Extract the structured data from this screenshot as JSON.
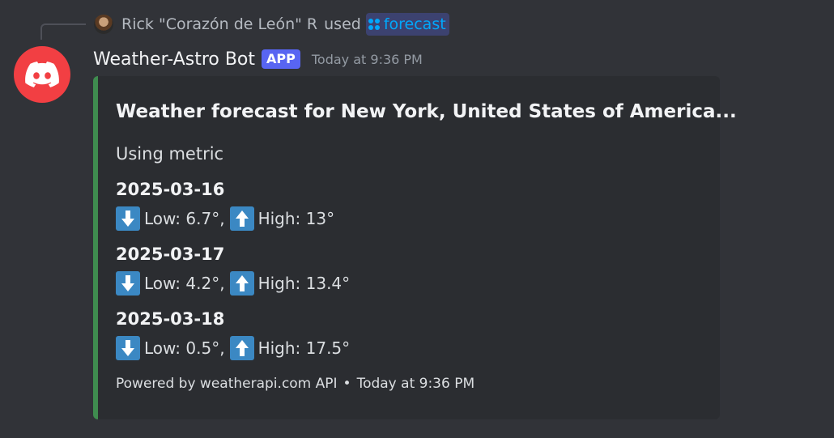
{
  "reply": {
    "user_name": "Rick \"Corazón de León\" R",
    "used_text": "used",
    "command": "forecast",
    "command_icon": "slash-command-icon"
  },
  "message": {
    "bot_name": "Weather-Astro Bot",
    "badge": "APP",
    "timestamp": "Today at 9:36 PM",
    "avatar_icon": "discord-logo-icon",
    "avatar_color": "#f23f43"
  },
  "embed": {
    "accent_color": "#3f8c4f",
    "title": "Weather forecast for New York, United States of America...",
    "description": "Using metric",
    "days": [
      {
        "date": "2025-03-16",
        "low": "Low: 6.7°,",
        "high": "High: 13°"
      },
      {
        "date": "2025-03-17",
        "low": "Low: 4.2°,",
        "high": "High: 13.4°"
      },
      {
        "date": "2025-03-18",
        "low": "Low: 0.5°,",
        "high": "High: 17.5°"
      }
    ],
    "footer_text": "Powered by weatherapi.com API",
    "footer_separator": "•",
    "footer_timestamp": "Today at 9:36 PM"
  }
}
